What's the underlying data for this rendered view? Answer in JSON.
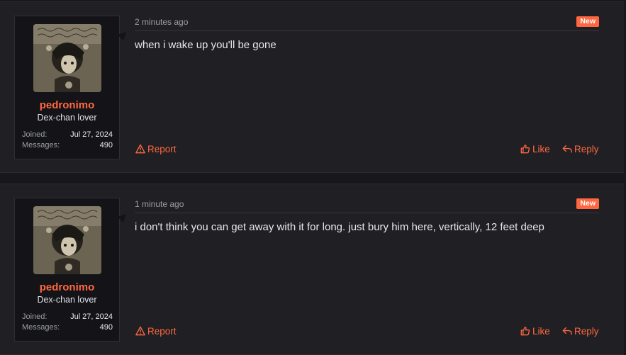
{
  "posts": [
    {
      "author": "pedronimo",
      "user_title": "Dex-chan lover",
      "joined_label": "Joined:",
      "joined_value": "Jul 27, 2024",
      "messages_label": "Messages:",
      "messages_value": "490",
      "time": "2 minutes ago",
      "badge": "New",
      "text": "when i wake up you'll be gone",
      "actions": {
        "report": "Report",
        "like": "Like",
        "reply": "Reply"
      }
    },
    {
      "author": "pedronimo",
      "user_title": "Dex-chan lover",
      "joined_label": "Joined:",
      "joined_value": "Jul 27, 2024",
      "messages_label": "Messages:",
      "messages_value": "490",
      "time": "1 minute ago",
      "badge": "New",
      "text": "i don't think you can get away with it for long. just bury him here, vertically, 12 feet deep",
      "actions": {
        "report": "Report",
        "like": "Like",
        "reply": "Reply"
      }
    }
  ],
  "icons": {
    "avatar": "avatar-image",
    "report": "warning-triangle-icon",
    "like": "thumbs-up-icon",
    "reply": "reply-arrow-icon"
  },
  "colors": {
    "accent": "#ff6740",
    "background": "#17171c",
    "post_background": "#202024",
    "card_background": "#141418",
    "muted_text": "#9a9ea6",
    "text": "#e6e8ec"
  }
}
